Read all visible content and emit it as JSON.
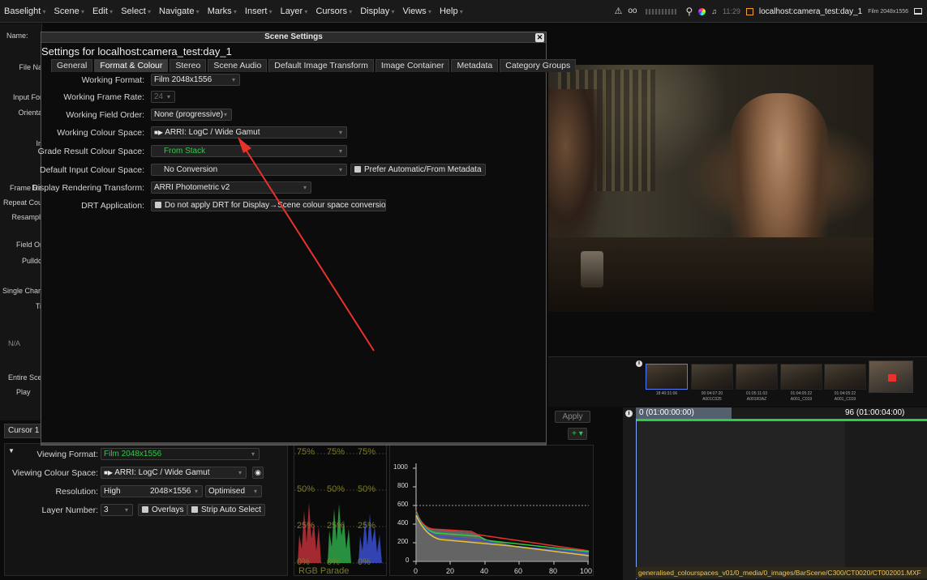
{
  "menubar": {
    "items": [
      "Baselight",
      "Scene",
      "Edit",
      "Select",
      "Navigate",
      "Marks",
      "Insert",
      "Layer",
      "Cursors",
      "Display",
      "Views",
      "Help"
    ],
    "time": "11:29",
    "host": "localhost:camera_test:day_1",
    "format_tag": "Film 2048x1556"
  },
  "left_panel": {
    "labels": [
      "Name:",
      "File Na",
      "Input For",
      "Orienta",
      "In",
      "Frame Ra",
      "Repeat Cou",
      "Resampli",
      "Field Or",
      "Pulldo",
      "Single Chan",
      "Tr",
      "N/A",
      "Entire Scen",
      "Play"
    ]
  },
  "dialog": {
    "title": "Scene Settings",
    "heading": "Settings for localhost:camera_test:day_1",
    "tabs": [
      "General",
      "Format & Colour",
      "Stereo",
      "Scene Audio",
      "Default Image Transform",
      "Image Container",
      "Metadata",
      "Category Groups"
    ],
    "active_tab": "Format & Colour",
    "fields": {
      "working_format": {
        "label": "Working Format:",
        "value": "Film 2048x1556"
      },
      "working_frame_rate": {
        "label": "Working Frame Rate:",
        "value": "24"
      },
      "working_field_order": {
        "label": "Working Field Order:",
        "value": "None (progressive)"
      },
      "working_colour_space": {
        "label": "Working Colour Space:",
        "value": "ARRI: LogC / Wide Gamut"
      },
      "grade_result_colour_space": {
        "label": "Grade Result Colour Space:",
        "value": "From Stack"
      },
      "default_input_colour_space": {
        "label": "Default Input Colour Space:",
        "value": "No Conversion"
      },
      "prefer_automatic": {
        "label": "Prefer Automatic/From Metadata"
      },
      "display_rendering_transform": {
        "label": "Display Rendering Transform:",
        "value": "ARRI Photometric v2"
      },
      "drt_application": {
        "label": "DRT Application:",
        "value": "Do not apply DRT for Display→Scene colour space conversions"
      }
    }
  },
  "timeline_strip": {
    "thumbs": [
      {
        "tc": "18:40:31:06",
        "name": ""
      },
      {
        "tc": "00:04:07:20",
        "name": "A001C025"
      },
      {
        "tc": "01:05:11:03",
        "name": "A001R3AZ"
      },
      {
        "tc": "01:04:05:22",
        "name": "A001_C019"
      },
      {
        "tc": "01:04:05:22",
        "name": "A001_C019"
      }
    ],
    "apply_label": "Apply"
  },
  "timeline": {
    "start_label": "0 (01:00:00:00)",
    "end_label": "96 (01:00:04:00)",
    "file_path": "generalised_colourspaces_v01/0_media/0_images/BarScene/C300/CT0020/CT002001.MXF"
  },
  "cursor_panel": {
    "tab": "Cursor 1",
    "viewing_format": {
      "label": "Viewing Format:",
      "value": "Film 2048x1556"
    },
    "viewing_colour_space": {
      "label": "Viewing Colour Space:",
      "value": "ARRI: LogC / Wide Gamut"
    },
    "resolution": {
      "label": "Resolution:",
      "value": "High",
      "dims": "2048×1556",
      "mode": "Optimised"
    },
    "layer_number": {
      "label": "Layer Number:",
      "value": "3"
    },
    "overlays_label": "Overlays",
    "strip_auto_label": "Strip Auto Select"
  },
  "scopes": {
    "parade_title": "RGB Parade",
    "levels": [
      "75%",
      "50%",
      "25%",
      "0%"
    ]
  },
  "graph": {
    "y_ticks": [
      "1000",
      "800",
      "600",
      "400",
      "200",
      "0"
    ],
    "x_ticks": [
      "0",
      "20",
      "40",
      "60",
      "80",
      "100"
    ]
  },
  "colors": {
    "accent_green": "#2fcb4a",
    "annotation_red": "#e8322b",
    "highlight_blue": "#4f7cff"
  }
}
